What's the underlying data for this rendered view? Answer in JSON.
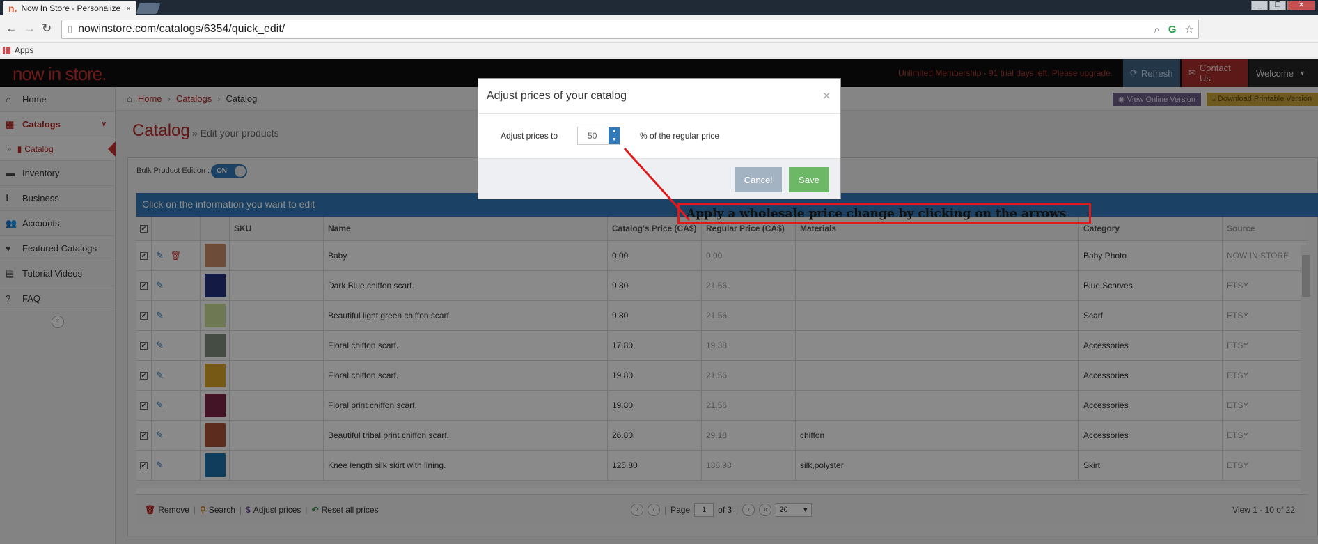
{
  "browser": {
    "tab_title": "Now In Store - Personalize",
    "tab_close": "×",
    "tab_icon_glyph": "n.",
    "url": "nowinstore.com/catalogs/6354/quick_edit/",
    "bookmarks_label": "Apps"
  },
  "header": {
    "logo": "now in store.",
    "trial_notice": "Unlimited Membership - 91 trial days left. Please upgrade.",
    "refresh_label": "Refresh",
    "contact_label": "Contact Us",
    "welcome_label": "Welcome"
  },
  "sidebar": {
    "items": [
      {
        "label": "Home",
        "icon": "home-icon"
      },
      {
        "label": "Catalogs",
        "icon": "grid-icon"
      },
      {
        "label": "Catalog",
        "icon": "book-icon"
      },
      {
        "label": "Inventory",
        "icon": "box-icon"
      },
      {
        "label": "Business",
        "icon": "info-icon"
      },
      {
        "label": "Accounts",
        "icon": "users-icon"
      },
      {
        "label": "Featured Catalogs",
        "icon": "heart-icon"
      },
      {
        "label": "Tutorial Videos",
        "icon": "film-icon"
      },
      {
        "label": "FAQ",
        "icon": "question-icon"
      }
    ],
    "collapse": "«"
  },
  "breadcrumb": {
    "home": "Home",
    "catalogs": "Catalogs",
    "current": "Catalog"
  },
  "actions": {
    "view_online": "View Online Version",
    "download_printable": "Download Printable Version"
  },
  "page": {
    "title": "Catalog",
    "subtitle": "» Edit your products"
  },
  "bulk": {
    "label": "Bulk Product Edition :",
    "toggle": "ON"
  },
  "grid": {
    "caption": "Click on the information you want to edit",
    "columns": [
      "SKU",
      "Name",
      "Catalog's Price (CA$)",
      "Regular Price (CA$)",
      "Materials",
      "Category",
      "Source"
    ],
    "rows": [
      {
        "sku": "",
        "name": "Baby",
        "catalog_price": "0.00",
        "regular_price": "0.00",
        "materials": "",
        "category": "Baby Photo",
        "source": "NOW IN STORE",
        "thumb": "#c98a6a"
      },
      {
        "sku": "",
        "name": "Dark Blue chiffon scarf.",
        "catalog_price": "9.80",
        "regular_price": "21.56",
        "materials": "",
        "category": "Blue Scarves",
        "source": "ETSY",
        "thumb": "#23307a"
      },
      {
        "sku": "",
        "name": "Beautiful light green chiffon scarf",
        "catalog_price": "9.80",
        "regular_price": "21.56",
        "materials": "",
        "category": "Scarf",
        "source": "ETSY",
        "thumb": "#c9dc9a"
      },
      {
        "sku": "",
        "name": "Floral chiffon scarf.",
        "catalog_price": "17.80",
        "regular_price": "19.38",
        "materials": "",
        "category": "Accessories",
        "source": "ETSY",
        "thumb": "#7d8a7a"
      },
      {
        "sku": "",
        "name": "Floral chiffon scarf.",
        "catalog_price": "19.80",
        "regular_price": "21.56",
        "materials": "",
        "category": "Accessories",
        "source": "ETSY",
        "thumb": "#d6a325"
      },
      {
        "sku": "",
        "name": "Floral print chiffon scarf.",
        "catalog_price": "19.80",
        "regular_price": "21.56",
        "materials": "",
        "category": "Accessories",
        "source": "ETSY",
        "thumb": "#7a2346"
      },
      {
        "sku": "",
        "name": "Beautiful tribal print  chiffon scarf.",
        "catalog_price": "26.80",
        "regular_price": "29.18",
        "materials": "chiffon",
        "category": "Accessories",
        "source": "ETSY",
        "thumb": "#a8503a"
      },
      {
        "sku": "",
        "name": "Knee length silk skirt with lining.",
        "catalog_price": "125.80",
        "regular_price": "138.98",
        "materials": "silk,polyster",
        "category": "Skirt",
        "source": "ETSY",
        "thumb": "#1e6fa8"
      }
    ]
  },
  "pager": {
    "remove": "Remove",
    "search": "Search",
    "adjust": "Adjust prices",
    "reset": "Reset all prices",
    "page_label": "Page",
    "page_value": "1",
    "of_label": "of 3",
    "rows_per_page": "20",
    "view_count": "View 1 - 10 of 22"
  },
  "modal": {
    "title": "Adjust prices of your catalog",
    "close": "×",
    "field_label": "Adjust prices to",
    "field_value": "50",
    "field_suffix": "% of the regular price",
    "cancel": "Cancel",
    "save": "Save"
  },
  "annotation": {
    "text": "Apply a wholesale price change by clicking on the arrows",
    "color": "#e01a1a"
  }
}
